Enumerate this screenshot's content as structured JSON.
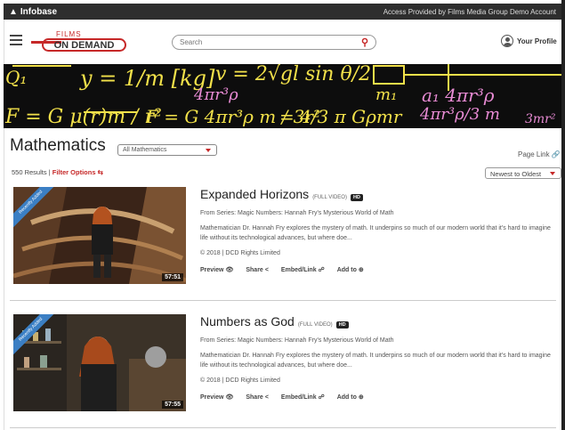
{
  "topbar": {
    "brand": "Infobase",
    "access": "Access Provided by Films Media Group Demo Account"
  },
  "header": {
    "logo_top": "FILMS",
    "logo_main": "ON DEMAND",
    "search_placeholder": "Search",
    "profile_label": "Your Profile"
  },
  "banner": {
    "row1": [
      "Q₁",
      "y = 1/m [kg]",
      "v = 2√gl sin θ/2",
      "m₁",
      "4πr³ρ",
      "a₁  4πr³ρ"
    ],
    "row2": [
      "F = G μ(r)m / r²",
      "F = G 4πr³ρ m / 3r²",
      "= 4/3 π Gρmr",
      "4πr³ρ/3 m",
      "3mr²"
    ]
  },
  "page": {
    "title": "Mathematics",
    "subject_select": "All Mathematics",
    "page_link": "Page Link",
    "results": "550 Results |",
    "filter_options": "Filter Options",
    "sort": "Newest to Oldest"
  },
  "videos": [
    {
      "title": "Expanded Horizons",
      "type_label": "(FULL VIDEO)",
      "hd": "HD",
      "series": "From Series: Magic Numbers: Hannah Fry's Mysterious World of Math",
      "description": "Mathematician Dr. Hannah Fry explores the mystery of math. It underpins so much of our modern world that it's hard to imagine life without its technological advances, but where doe...",
      "copyright": "© 2018 | DCD Rights Limited",
      "duration": "57:51",
      "ribbon": "Recently Added",
      "actions": {
        "preview": "Preview",
        "share": "Share",
        "embed": "Embed/Link",
        "add": "Add to"
      }
    },
    {
      "title": "Numbers as God",
      "type_label": "(FULL VIDEO)",
      "hd": "HD",
      "series": "From Series: Magic Numbers: Hannah Fry's Mysterious World of Math",
      "description": "Mathematician Dr. Hannah Fry explores the mystery of math. It underpins so much of our modern world that it's hard to imagine life without its technological advances, but where doe...",
      "copyright": "© 2018 | DCD Rights Limited",
      "duration": "57:55",
      "ribbon": "Recently Added",
      "actions": {
        "preview": "Preview",
        "share": "Share",
        "embed": "Embed/Link",
        "add": "Add to"
      }
    }
  ],
  "colors": {
    "accent": "#c62828",
    "topbar": "#2e2e2e",
    "ribbon": "#3b7fc4",
    "banner_yellow": "#f2e14a",
    "banner_pink": "#e88bd4"
  }
}
